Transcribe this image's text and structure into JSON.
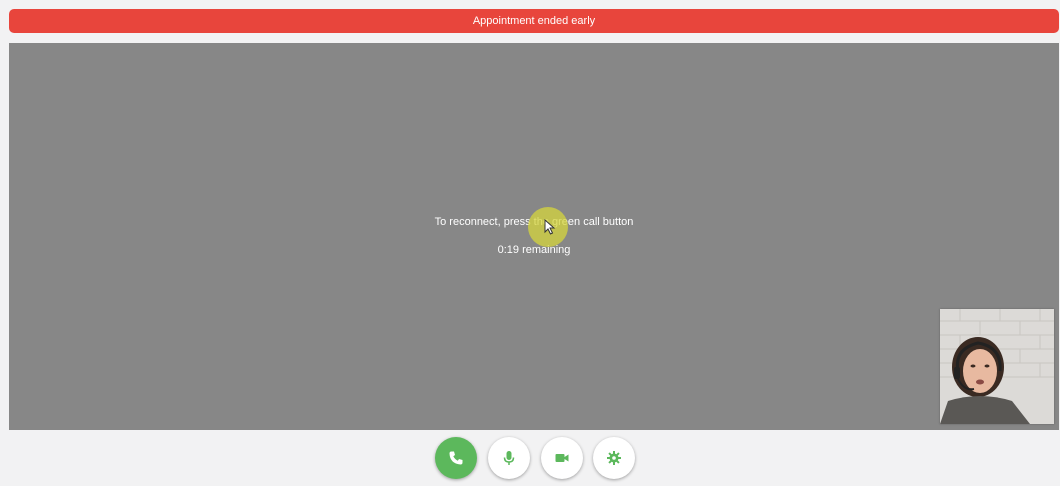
{
  "banner": {
    "text": "Appointment ended early",
    "color": "#e8453c"
  },
  "video_area": {
    "reconnect_message": "To reconnect, press the green call button",
    "countdown_text": "0:19 remaining",
    "background_color": "#878787"
  },
  "self_view": {
    "description_icon": "participant-video-thumbnail"
  },
  "controls": {
    "buttons": [
      {
        "icon": "phone-icon",
        "color": "#5cb85c"
      },
      {
        "icon": "microphone-icon",
        "color": "#5cb85c"
      },
      {
        "icon": "video-camera-icon",
        "color": "#5cb85c"
      },
      {
        "icon": "gear-icon",
        "color": "#5cb85c"
      }
    ]
  }
}
